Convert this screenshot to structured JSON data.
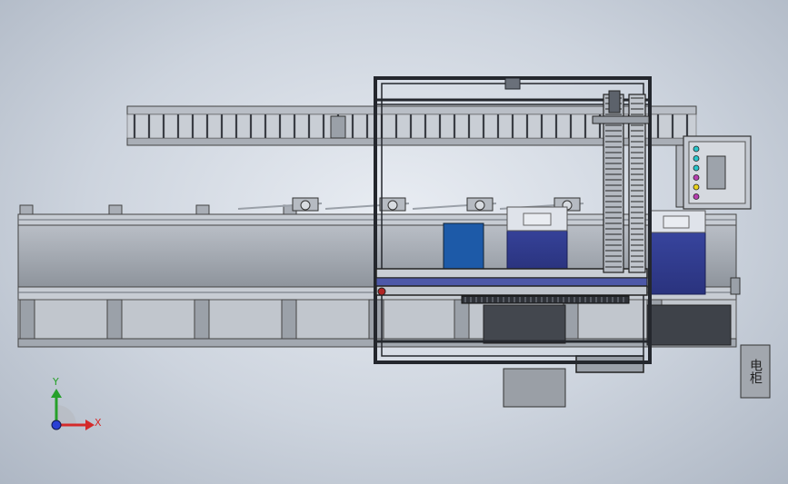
{
  "cabinet_label": "电柜",
  "triad": {
    "x_label": "X",
    "y_label": "Y"
  },
  "colors": {
    "frame": "#2a2d33",
    "steel_light": "#c7ccd3",
    "steel_mid": "#9aa0a8",
    "steel_dark": "#5c626b",
    "blue_box": "#33409a",
    "blue_door": "#1d5aa8",
    "axis_x": "#d42a2a",
    "axis_y": "#26a02a",
    "axis_z": "#2a3fd4"
  },
  "indicator_colors": [
    "#29c4c9",
    "#29c4c9",
    "#29c4c9",
    "#b73fb0",
    "#e8d21c",
    "#b73fb0"
  ]
}
